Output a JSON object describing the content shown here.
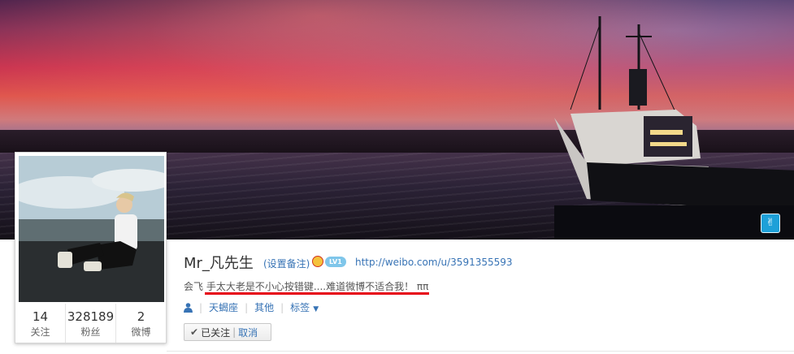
{
  "profile": {
    "name": "Mr_凡先生",
    "remark_link": "(设置备注)",
    "level_badge": "LV1",
    "url": "http://weibo.com/u/3591355593",
    "bio": "会飞 手太大老是不小心按错键....难道微博不适合我！ ππ"
  },
  "stats": [
    {
      "value": "14",
      "label": "关注"
    },
    {
      "value": "328189",
      "label": "粉丝"
    },
    {
      "value": "2",
      "label": "微博"
    }
  ],
  "tags": {
    "constellation": "天蝎座",
    "other": "其他",
    "tags_menu": "标签"
  },
  "follow": {
    "followed_label": "已关注",
    "cancel_label": "取消"
  },
  "icons": {
    "cover_edit": "cover-icon",
    "person": "person-icon",
    "crown": "crown-icon",
    "check": "check-icon"
  },
  "colors": {
    "link": "#3773b5",
    "underline": "#e60012"
  }
}
